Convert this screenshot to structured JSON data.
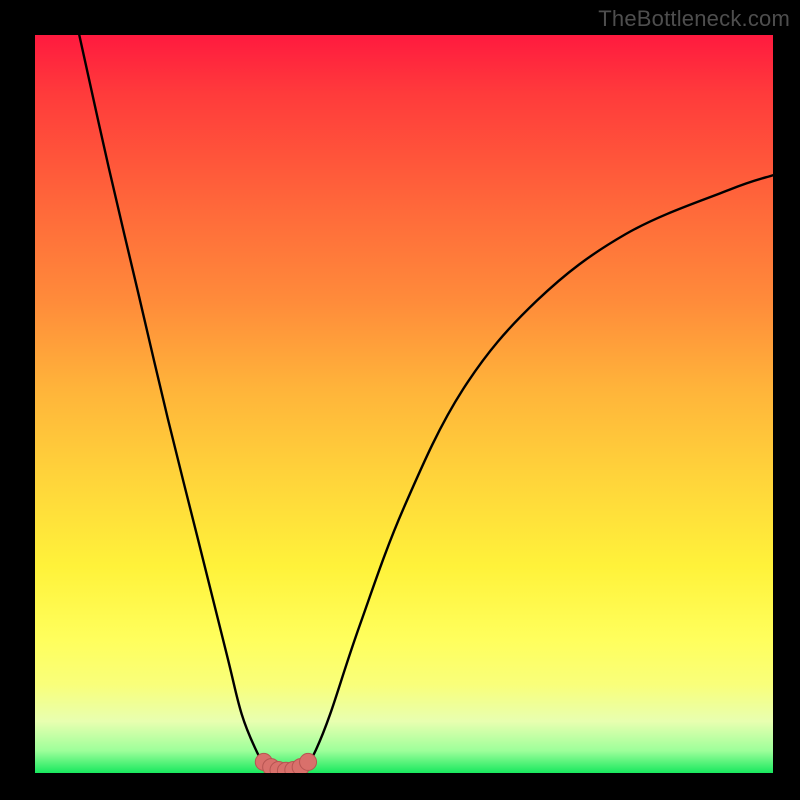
{
  "watermark": "TheBottleneck.com",
  "colors": {
    "frame": "#000000",
    "gradient_top": "#ff1a3f",
    "gradient_mid": "#ffd43a",
    "gradient_bottom": "#18e85e",
    "curve": "#000000",
    "marker_fill": "#d9706b",
    "marker_stroke": "#b75552"
  },
  "chart_data": {
    "type": "line",
    "title": "",
    "xlabel": "",
    "ylabel": "",
    "xlim": [
      0,
      100
    ],
    "ylim": [
      0,
      100
    ],
    "series": [
      {
        "name": "left-branch",
        "x": [
          6,
          10,
          14,
          18,
          22,
          26,
          28,
          30,
          31,
          32
        ],
        "values": [
          100,
          82,
          65,
          48,
          32,
          16,
          8,
          3,
          1.5,
          0.8
        ]
      },
      {
        "name": "right-branch",
        "x": [
          36,
          37,
          38,
          40,
          44,
          50,
          58,
          68,
          80,
          94,
          100
        ],
        "values": [
          0.8,
          1.5,
          3,
          8,
          20,
          36,
          52,
          64,
          73,
          79,
          81
        ]
      },
      {
        "name": "valley-floor",
        "x": [
          32,
          33,
          34,
          35,
          36
        ],
        "values": [
          0.8,
          0.4,
          0.3,
          0.4,
          0.8
        ]
      }
    ],
    "markers": {
      "name": "valley-markers",
      "x": [
        31,
        32,
        33,
        34,
        35,
        36,
        37
      ],
      "values": [
        1.5,
        0.8,
        0.4,
        0.3,
        0.4,
        0.8,
        1.5
      ]
    }
  }
}
